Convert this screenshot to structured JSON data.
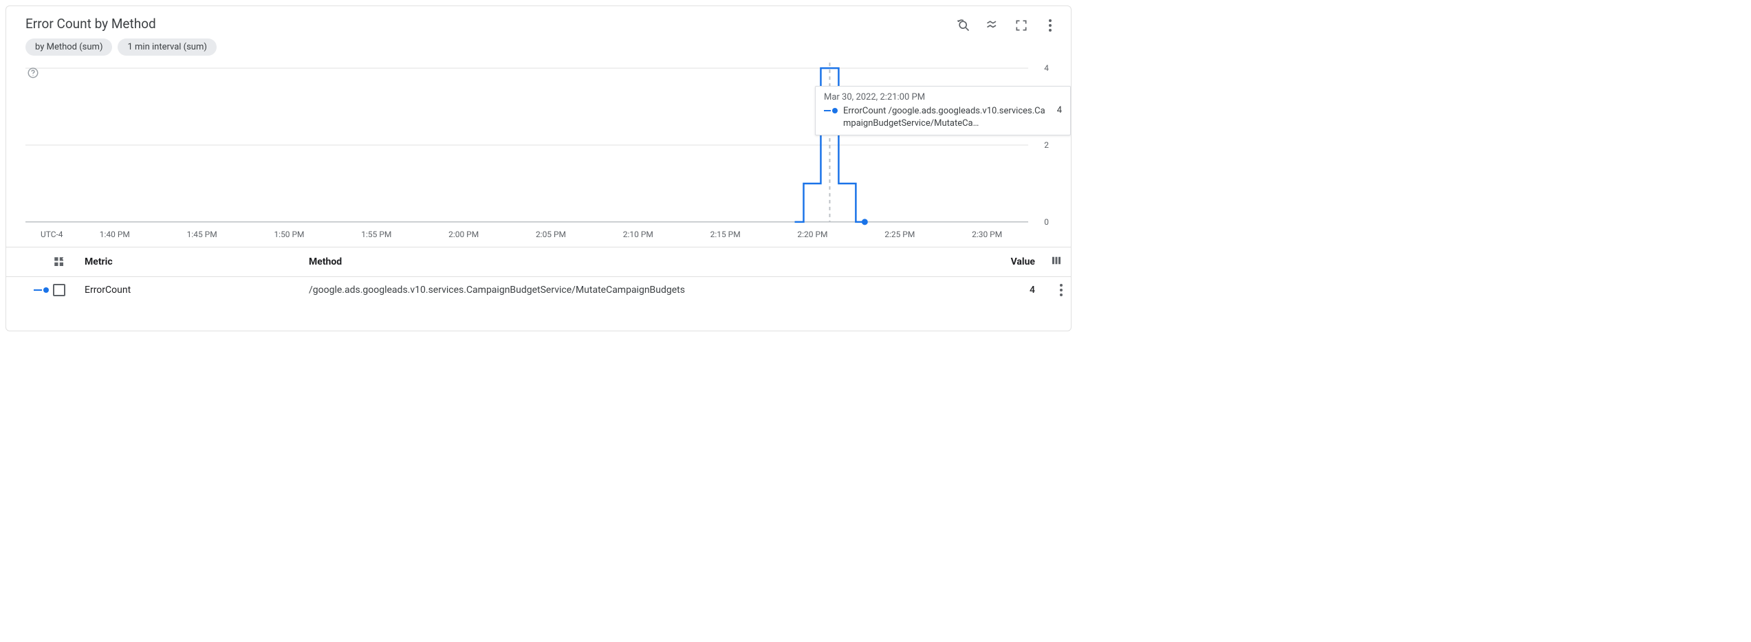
{
  "title": "Error Count by Method",
  "chips": {
    "group": "by Method (sum)",
    "interval": "1 min interval (sum)"
  },
  "chart_data": {
    "type": "line",
    "xlabel": "",
    "ylabel": "",
    "ylim": [
      0,
      4
    ],
    "y_ticks": [
      0,
      2,
      4
    ],
    "x_ticks": [
      "UTC-4",
      "1:40 PM",
      "1:45 PM",
      "1:50 PM",
      "1:55 PM",
      "2:00 PM",
      "2:05 PM",
      "2:10 PM",
      "2:15 PM",
      "2:20 PM",
      "2:25 PM",
      "2:30 PM"
    ],
    "x_range_minutes": [
      37,
      33
    ],
    "series": [
      {
        "name": "ErrorCount /google.ads.googleads.v10.services.CampaignBudgetService/MutateCampaignBudgets",
        "color": "#1a73e8",
        "points": [
          {
            "t": "2:19 PM",
            "v": 0
          },
          {
            "t": "2:20 PM",
            "v": 1
          },
          {
            "t": "2:21 PM",
            "v": 4
          },
          {
            "t": "2:22 PM",
            "v": 1
          },
          {
            "t": "2:23 PM",
            "v": 0
          }
        ]
      }
    ],
    "cursor_time": "2:21 PM",
    "current_time_marker": "2:23 PM"
  },
  "tooltip": {
    "time": "Mar 30, 2022, 2:21:00 PM",
    "label": "ErrorCount /google.ads.googleads.v10.services.CampaignBudgetService/MutateCa…",
    "value": "4"
  },
  "table": {
    "head": {
      "metric": "Metric",
      "method": "Method",
      "value": "Value"
    },
    "rows": [
      {
        "metric": "ErrorCount",
        "method": "/google.ads.googleads.v10.services.CampaignBudgetService/MutateCampaignBudgets",
        "value": "4"
      }
    ]
  }
}
